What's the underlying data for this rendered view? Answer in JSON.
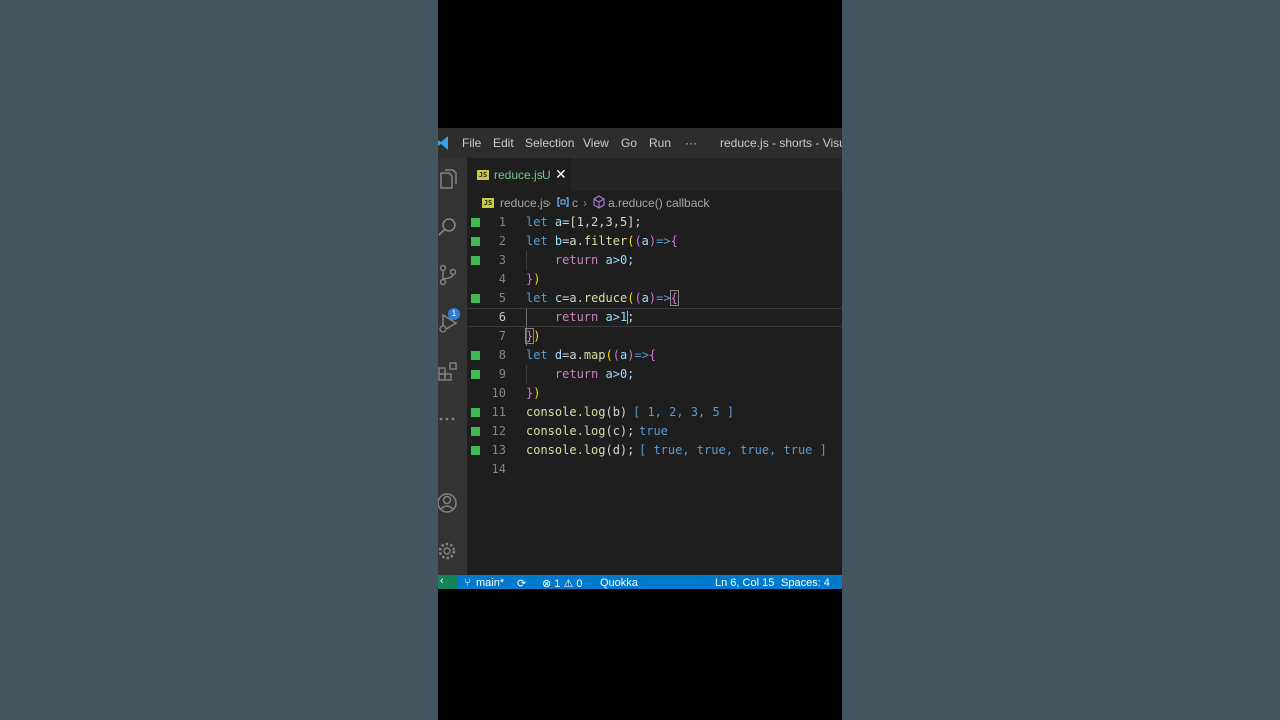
{
  "window": {
    "title": "reduce.js - shorts - Visual S",
    "menu": [
      "File",
      "Edit",
      "Selection",
      "View",
      "Go",
      "Run",
      "···"
    ]
  },
  "activity_bar": {
    "icons": [
      "files-icon",
      "search-icon",
      "source-control-icon",
      "run-debug-icon",
      "extensions-icon",
      "more-icon",
      "account-icon",
      "settings-gear-icon"
    ],
    "source_control_badge": "1"
  },
  "tab": {
    "icon_text": "JS",
    "filename": "reduce.js",
    "status": "U",
    "close": "✕"
  },
  "breadcrumb": {
    "file": "reduce.js",
    "symbol1": "c",
    "symbol2": "a.reduce() callback"
  },
  "editor": {
    "lines": [
      {
        "num": "1"
      },
      {
        "num": "2"
      },
      {
        "num": "3"
      },
      {
        "num": "4"
      },
      {
        "num": "5"
      },
      {
        "num": "6"
      },
      {
        "num": "7"
      },
      {
        "num": "8"
      },
      {
        "num": "9"
      },
      {
        "num": "10"
      },
      {
        "num": "11"
      },
      {
        "num": "12"
      },
      {
        "num": "13"
      },
      {
        "num": "14"
      }
    ],
    "tok": {
      "let": "let",
      "return": "return",
      "arrow": "=>",
      "l1_var": "a",
      "l1_rest": "=[1,2,3,5];",
      "l2_var": "b",
      "l2_mid": "=a.",
      "l2_fn": "filter",
      "paren_open": "(",
      "paren_close": ")",
      "param": "a",
      "brace_open": "{",
      "brace_close": "}",
      "l3_body": "a>0;",
      "l5_var": "c",
      "l5_fn": "reduce",
      "l6_body_a": "a>1",
      "l6_body_b": ";",
      "l8_var": "d",
      "l8_fn": "map",
      "l9_body": "a>0;",
      "console": "console.log",
      "l11_arg": "(b)",
      "l12_arg": "(c);",
      "l13_arg": "(d);"
    },
    "quokka": {
      "l11": "[ 1, 2, 3, 5 ]",
      "l12": "true",
      "l13": "[ true, true, true, true ]"
    }
  },
  "statusbar": {
    "remote": "‹",
    "branch": "main*",
    "sync": "⟳",
    "problems": "⊗ 1 ⚠ 0",
    "quokka": "Quokka",
    "position": "Ln 6, Col 15",
    "spaces": "Spaces: 4"
  },
  "colors": {
    "editor_bg": "#1e1e1e",
    "statusbar_bg": "#007acc",
    "gutter_added": "#3fb950",
    "quokka_value": "#5b9bd5"
  }
}
